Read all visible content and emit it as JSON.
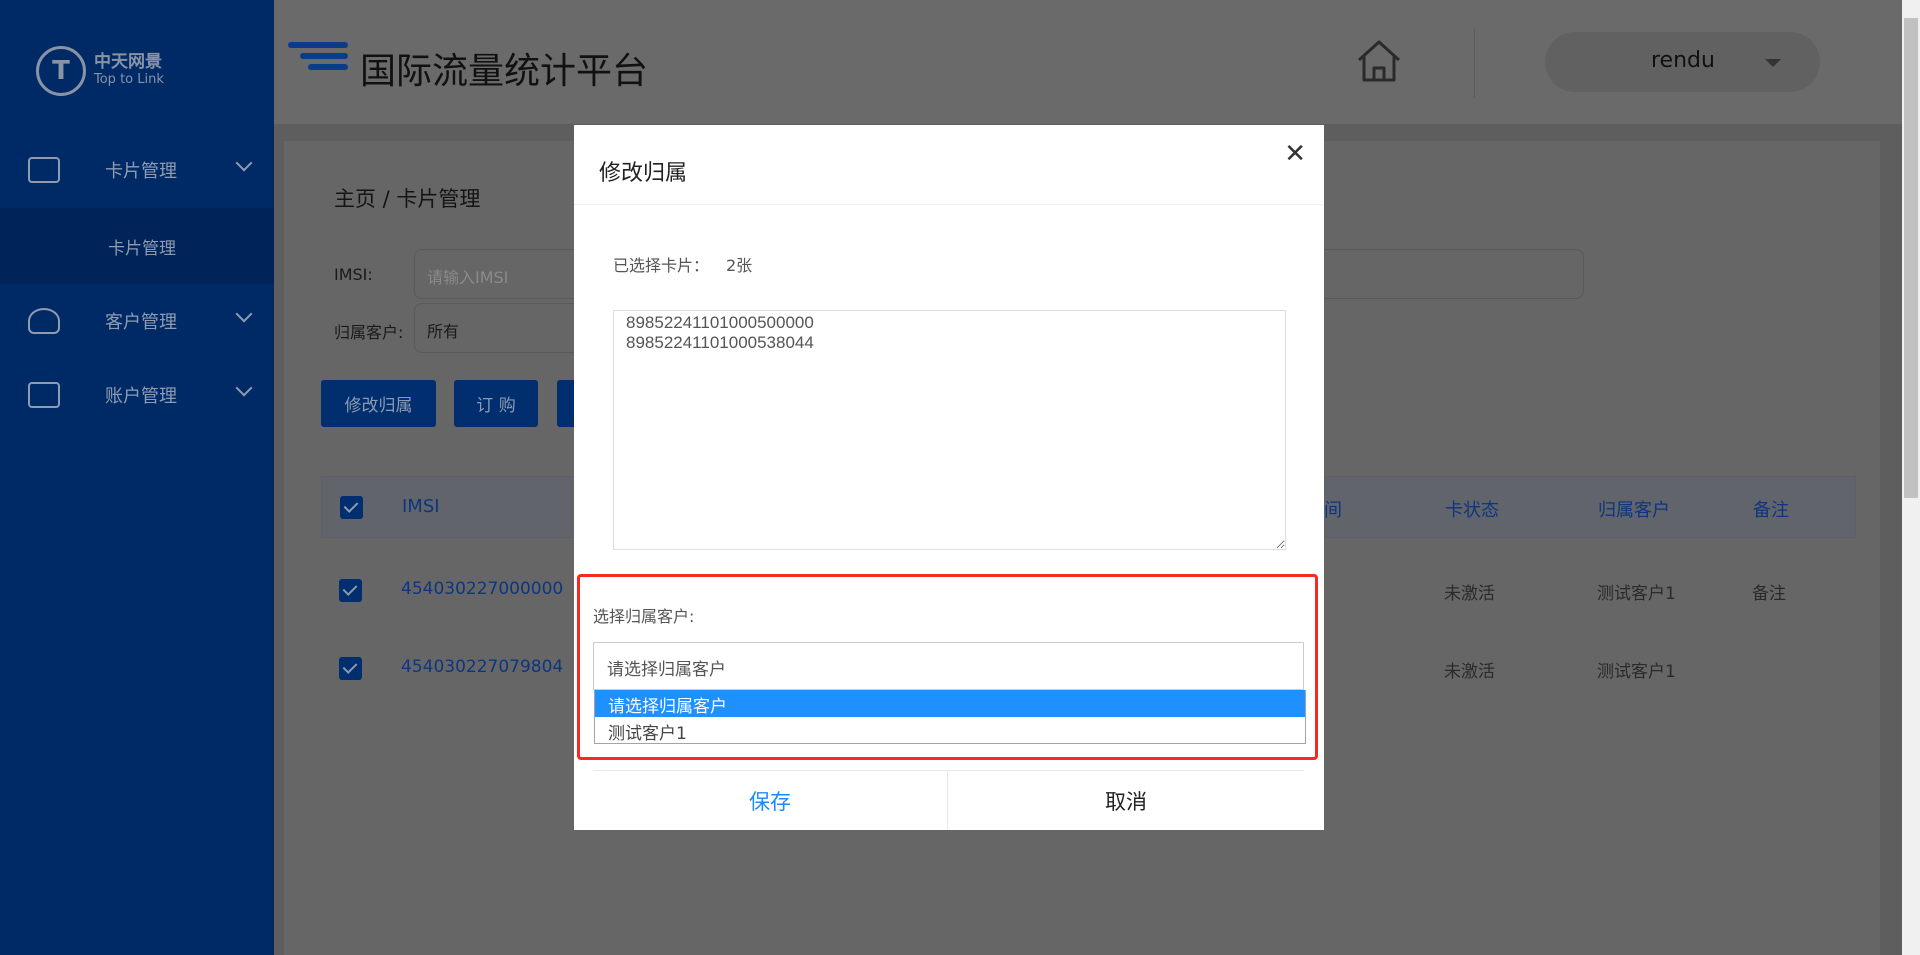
{
  "logo": {
    "cn": "中天网景",
    "en": "Top to Link"
  },
  "sidebar": {
    "items": [
      {
        "label": "卡片管理",
        "icon": "card-icon"
      },
      {
        "label": "客户管理",
        "icon": "users-icon"
      },
      {
        "label": "账户管理",
        "icon": "id-card-icon"
      }
    ],
    "sub_item": "卡片管理"
  },
  "header": {
    "title": "国际流量统计平台",
    "user": "rendu"
  },
  "main": {
    "breadcrumb": "主页 / 卡片管理",
    "filters": {
      "imsi_label": "IMSI:",
      "imsi_placeholder": "请输入IMSI",
      "customer_label": "归属客户:",
      "customer_value": "所有"
    },
    "buttons": [
      "修改归属",
      "订 购"
    ],
    "table": {
      "columns": [
        "IMSI",
        "间",
        "卡状态",
        "归属客户",
        "备注"
      ],
      "rows": [
        {
          "imsi": "454030227000000",
          "status": "未激活",
          "customer": "测试客户1",
          "note": "备注"
        },
        {
          "imsi": "454030227079804",
          "status": "未激活",
          "customer": "测试客户1",
          "note": ""
        }
      ]
    }
  },
  "dialog": {
    "title": "修改归属",
    "selected_label": "已选择卡片：",
    "selected_count": "2张",
    "iccids": "89852241101000500000\n89852241101000538044",
    "customer_label": "选择归属客户:",
    "select_value": "请选择归属客户",
    "options": [
      "请选择归属客户",
      "测试客户1"
    ],
    "save": "保存",
    "cancel": "取消"
  },
  "colors": {
    "accent": "#0a63e8",
    "highlight": "#1e90ff",
    "annotation": "#f52a23"
  }
}
